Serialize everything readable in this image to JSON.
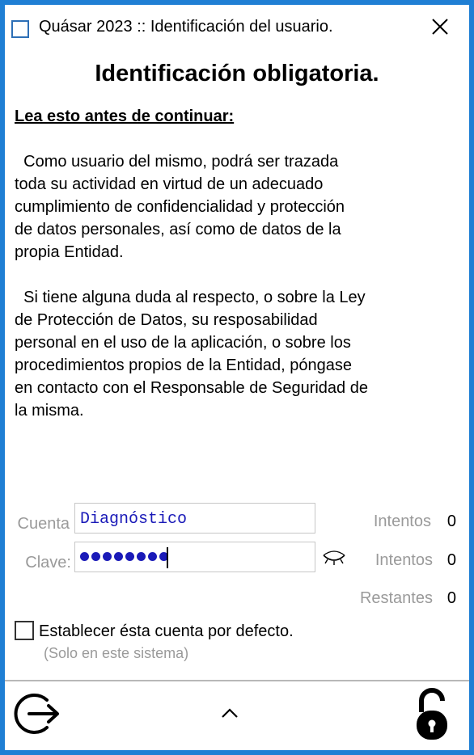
{
  "window": {
    "title": "Quásar 2023 :: Identificación del usuario."
  },
  "heading": "Identificación obligatoria.",
  "subheading": "Lea esto antes de continuar:",
  "paragraphs": [
    "  Como usuario del mismo, podrá ser trazada\ntoda su actividad en virtud de un adecuado\ncumplimiento de confidencialidad y protección\nde datos personales, así como de datos de la\npropia Entidad.",
    "  Si tiene alguna duda al respecto, o sobre la Ley\nde Protección de Datos, su resposabilidad\npersonal en el uso de la aplicación, o sobre los\nprocedimientos propios de la Entidad, póngase\nen contacto con el Responsable de Seguridad de\nla misma."
  ],
  "form": {
    "cuenta_label": "Cuenta",
    "cuenta_value": "Diagnóstico",
    "clave_label": "Clave:",
    "clave_masked_length": 8
  },
  "counters": [
    {
      "label": "Intentos",
      "value": "0"
    },
    {
      "label": "Intentos",
      "value": "0"
    },
    {
      "label": "Restantes",
      "value": "0"
    }
  ],
  "default_account": {
    "label": "Establecer ésta cuenta por defecto.",
    "note": "(Solo en este sistema)",
    "checked": false
  },
  "colors": {
    "border": "#1f7fd4",
    "input_text": "#1a1ab8",
    "muted": "#9a9a9a"
  },
  "icons": [
    "app-icon",
    "close-icon",
    "eye-closed-icon",
    "exit-icon",
    "chevron-up-icon",
    "unlock-icon"
  ]
}
